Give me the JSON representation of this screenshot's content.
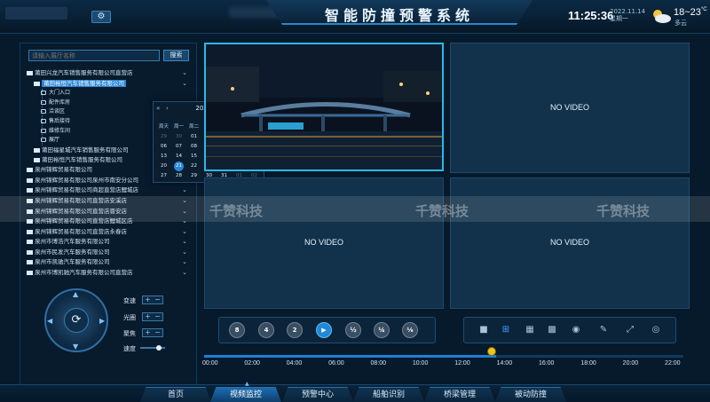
{
  "header": {
    "title": "智能防撞预警系统",
    "time": "11:25:36",
    "date": "2022.11.14",
    "weekday": "星期一",
    "temperature": "18~23",
    "temp_unit": "°C",
    "weather": "多云",
    "settings_icon": "gear-icon",
    "weather_icon": "partly-cloudy-icon"
  },
  "sidebar": {
    "search_placeholder": "请输入展厅名称",
    "search_button": "搜索",
    "tree": [
      {
        "label": "莆田兴龙汽车销售服务有限公司直营店",
        "level": 0,
        "expanded": true
      },
      {
        "label": "莆田裕恒汽车销售服务有限公司",
        "level": 1,
        "selected": true,
        "expanded": true
      },
      {
        "label": "大门入口",
        "level": 2
      },
      {
        "label": "配件库房",
        "level": 2
      },
      {
        "label": "洽谈区",
        "level": 2
      },
      {
        "label": "售后接待",
        "level": 2
      },
      {
        "label": "维修车间",
        "level": 2
      },
      {
        "label": "展厅",
        "level": 2
      },
      {
        "label": "莆田福星城汽车销售服务有限公司",
        "level": 1
      },
      {
        "label": "莆田裕恒汽车销售服务有限公司",
        "level": 1
      },
      {
        "label": "泉州锦辉贸易有限公司",
        "level": 0
      },
      {
        "label": "泉州锦辉贸易有限公司泉州市南安分公司",
        "level": 0
      },
      {
        "label": "泉州锦辉贸易有限公司商超直营店鲤城店",
        "level": 0
      },
      {
        "label": "泉州锦辉贸易有限公司直营店安溪店",
        "level": 0
      },
      {
        "label": "泉州锦辉贸易有限公司直营店晋安店",
        "level": 0
      },
      {
        "label": "泉州锦辉贸易有限公司直营店鲤城区店",
        "level": 0
      },
      {
        "label": "泉州锦辉贸易有限公司直营店永春店",
        "level": 0
      },
      {
        "label": "泉州市博浩汽车服务有限公司",
        "level": 0
      },
      {
        "label": "泉州市民发汽车服务有限公司",
        "level": 0
      },
      {
        "label": "泉州市凯驰汽车服务有限公司",
        "level": 0
      },
      {
        "label": "泉州市博凯驰汽车服务有限公司直营店",
        "level": 0
      }
    ]
  },
  "calendar": {
    "month": "2022-10",
    "weekdays": [
      "周天",
      "周一",
      "周二",
      "周三",
      "周四",
      "周五",
      "周六"
    ],
    "days": [
      [
        "25",
        "26",
        "27",
        "28",
        "29",
        "30",
        "01"
      ],
      [
        "02",
        "03",
        "04",
        "05",
        "06",
        "07",
        "08"
      ],
      [
        "09",
        "10",
        "11",
        "12",
        "13",
        "14",
        "15"
      ],
      [
        "16",
        "17",
        "18",
        "19",
        "20",
        "21",
        "22"
      ],
      [
        "23",
        "24",
        "25",
        "26",
        "27",
        "28",
        "29"
      ],
      [
        "30",
        "31",
        "01",
        "02",
        "03",
        "04",
        "05"
      ]
    ],
    "display_rows": [
      [
        "29",
        "30",
        "01",
        "02",
        "03",
        "04",
        "05"
      ],
      [
        "06",
        "07",
        "08",
        "09",
        "10",
        "11",
        "12"
      ],
      [
        "13",
        "14",
        "15",
        "16",
        "17",
        "18",
        "19"
      ],
      [
        "20",
        "21",
        "22",
        "23",
        "24",
        "25",
        "26"
      ],
      [
        "27",
        "28",
        "29",
        "30",
        "31",
        "01",
        "02"
      ]
    ],
    "today": "21"
  },
  "ptz": {
    "labels": [
      "变速",
      "光圈",
      "聚焦",
      "速度"
    ],
    "plus": "+",
    "minus": "−",
    "center_icon": "refresh-icon"
  },
  "videos": {
    "no_video": "NO VIDEO"
  },
  "watermark": "千赞科技",
  "playback": {
    "buttons": [
      "8",
      "4",
      "2",
      "▶",
      "½",
      "¼",
      "⅛"
    ],
    "layout_icons": [
      "single-view-icon",
      "quad-view-icon",
      "nine-view-icon",
      "sixteen-view-icon",
      "volume-icon",
      "edit-icon",
      "fullscreen-icon",
      "snapshot-icon"
    ],
    "progress": 0.61
  },
  "timeline": {
    "ticks": [
      "00:00",
      "02:00",
      "04:00",
      "06:00",
      "08:00",
      "10:00",
      "12:00",
      "14:00",
      "16:00",
      "18:00",
      "20:00",
      "22:00"
    ]
  },
  "nav": {
    "tabs": [
      "首页",
      "视频监控",
      "预警中心",
      "船舶识别",
      "桥梁管理",
      "被动防撞"
    ],
    "active": 1
  }
}
